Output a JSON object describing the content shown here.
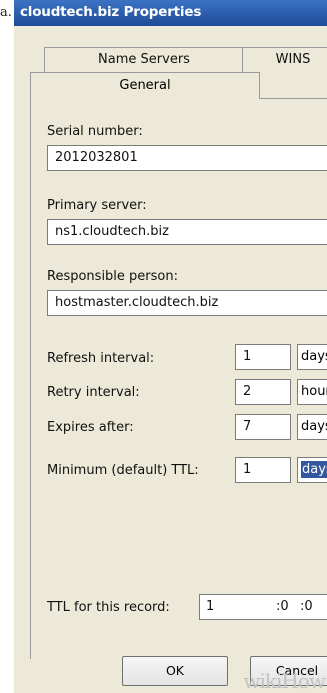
{
  "stray_prefix": "a.",
  "window": {
    "title": "cloudtech.biz Properties"
  },
  "tabs": {
    "name_servers": "Name Servers",
    "wins": "WINS",
    "general": "General"
  },
  "serial": {
    "label": "Serial number:",
    "value": "2012032801"
  },
  "primary": {
    "label": "Primary server:",
    "value": "ns1.cloudtech.biz"
  },
  "responsible": {
    "label": "Responsible person:",
    "value": "hostmaster.cloudtech.biz"
  },
  "refresh": {
    "label": "Refresh interval:",
    "value": "1",
    "unit": "days"
  },
  "retry": {
    "label": "Retry interval:",
    "value": "2",
    "unit": "hours"
  },
  "expires": {
    "label": "Expires after:",
    "value": "7",
    "unit": "days"
  },
  "min_ttl": {
    "label": "Minimum (default) TTL:",
    "value": "1",
    "unit": "days"
  },
  "record_ttl": {
    "label": "TTL for this record:",
    "days": "1",
    "hours": ":0",
    "minutes": ":0"
  },
  "buttons": {
    "ok": "OK",
    "cancel": "Cancel"
  },
  "watermark": "wikiHow"
}
